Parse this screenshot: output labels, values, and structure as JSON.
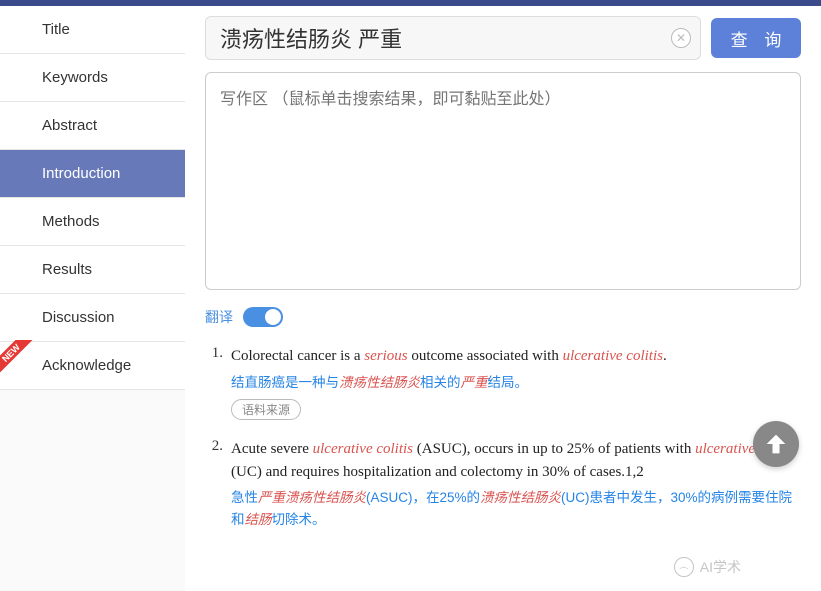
{
  "sidebar": {
    "items": [
      {
        "label": "Title",
        "active": false
      },
      {
        "label": "Keywords",
        "active": false
      },
      {
        "label": "Abstract",
        "active": false
      },
      {
        "label": "Introduction",
        "active": true
      },
      {
        "label": "Methods",
        "active": false
      },
      {
        "label": "Results",
        "active": false
      },
      {
        "label": "Discussion",
        "active": false
      },
      {
        "label": "Acknowledge",
        "active": false,
        "new": true
      }
    ],
    "new_badge": "NEW"
  },
  "search": {
    "value": "溃疡性结肠炎 严重"
  },
  "query_button": "查 询",
  "writing_placeholder": "写作区 （鼠标单击搜索结果，即可黏贴至此处）",
  "translate": {
    "label": "翻译",
    "on": true
  },
  "source_button": "语料来源",
  "watermark": "AI学术",
  "results": [
    {
      "num": "1.",
      "en_parts": [
        "Colorectal cancer is a ",
        {
          "hl": "serious"
        },
        " outcome associated with ",
        {
          "hl": "ulcerative colitis"
        },
        "."
      ],
      "cn_parts": [
        "结直肠癌是一种与",
        {
          "hl": "溃疡性结肠炎"
        },
        "相关的",
        {
          "hl": "严重"
        },
        "结局。"
      ],
      "show_source": true
    },
    {
      "num": "2.",
      "en_parts": [
        "Acute severe ",
        {
          "hl": "ulcerative colitis"
        },
        " (ASUC), occurs in up to 25% of patients with ",
        {
          "hl": "ulcerative colitis"
        },
        " (UC) and requires hospitalization and colectomy in 30% of cases.1,2"
      ],
      "cn_parts": [
        "急性",
        {
          "hl": "严重溃疡性结肠炎"
        },
        "(ASUC)，在25%的",
        {
          "hl": "溃疡性结肠炎"
        },
        "(UC)患者中发生，30%的病例需要住院和",
        {
          "hl": "结肠"
        },
        "切除术。"
      ],
      "show_source": false
    }
  ]
}
